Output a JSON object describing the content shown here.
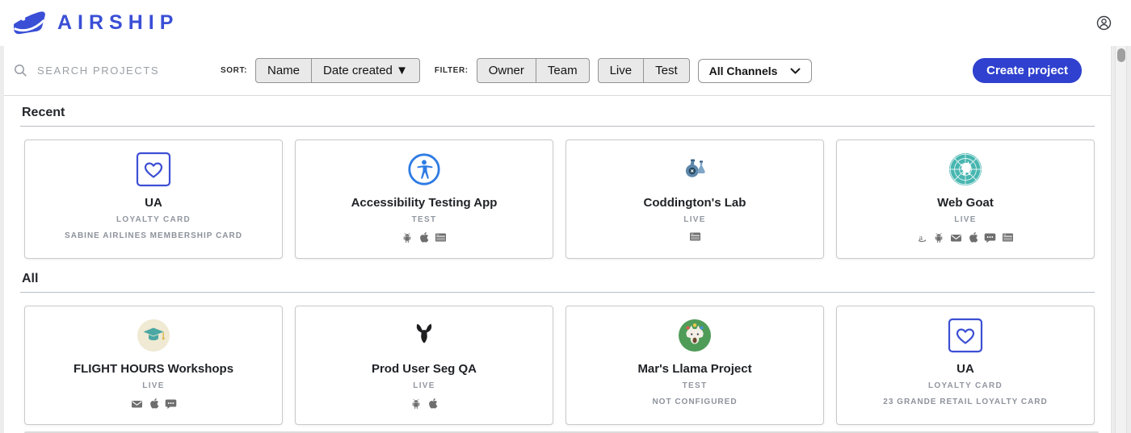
{
  "header": {
    "logo_text": "AIRSHIP"
  },
  "toolbar": {
    "search_placeholder": "SEARCH PROJECTS",
    "sort_label": "SORT:",
    "sort_buttons": [
      "Name",
      "Date created ▼"
    ],
    "filter_label": "FILTER:",
    "filter_groups": [
      [
        "Owner",
        "Team"
      ],
      [
        "Live",
        "Test"
      ]
    ],
    "channels_dropdown_value": "All Channels",
    "create_button_label": "Create project"
  },
  "sections": [
    {
      "title": "Recent",
      "projects": [
        {
          "name": "UA",
          "status": "LOYALTY CARD",
          "description": "SABINE AIRLINES MEMBERSHIP CARD",
          "avatar": "heart-square",
          "channels": []
        },
        {
          "name": "Accessibility Testing App",
          "status": "TEST",
          "description": "",
          "avatar": "accessibility",
          "channels": [
            "android",
            "apple",
            "web"
          ]
        },
        {
          "name": "Coddington's Lab",
          "status": "LIVE",
          "description": "",
          "avatar": "lab-flasks",
          "channels": [
            "web"
          ]
        },
        {
          "name": "Web Goat",
          "status": "LIVE",
          "description": "",
          "avatar": "web-goat",
          "channels": [
            "amazon",
            "android",
            "email",
            "apple",
            "sms",
            "web"
          ]
        }
      ]
    },
    {
      "title": "All",
      "projects": [
        {
          "name": "FLIGHT HOURS Workshops",
          "status": "LIVE",
          "description": "",
          "avatar": "graduation-cap",
          "channels": [
            "email",
            "apple",
            "sms"
          ]
        },
        {
          "name": "Prod User Seg QA",
          "status": "LIVE",
          "description": "",
          "avatar": "goat-head",
          "channels": [
            "android",
            "apple"
          ]
        },
        {
          "name": "Mar's Llama Project",
          "status": "TEST",
          "description": "NOT CONFIGURED",
          "avatar": "llama",
          "channels": []
        },
        {
          "name": "UA",
          "status": "LOYALTY CARD",
          "description": "23 GRANDE RETAIL LOYALTY CARD",
          "avatar": "heart-square",
          "channels": []
        }
      ]
    }
  ],
  "colors": {
    "brand_blue": "#3A4FD6",
    "create_button_blue": "#2F41CE",
    "heart_icon_blue": "#3D4FD4",
    "accessibility_blue": "#2E7BE4",
    "webgoat_teal": "#47B6B0",
    "gradcap_cream": "#F0E9D3",
    "llama_green": "#4F9C58",
    "status_gray": "#9196A0"
  }
}
